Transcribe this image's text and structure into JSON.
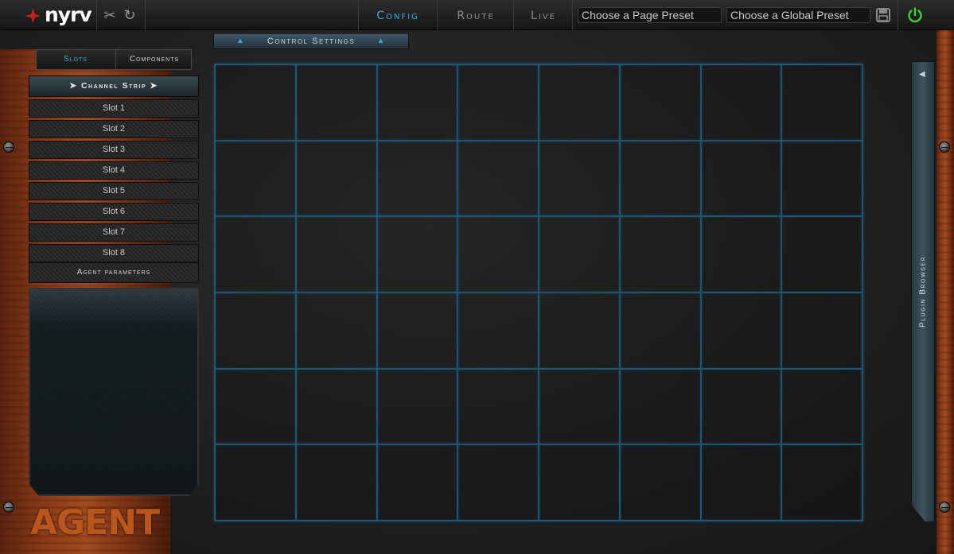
{
  "header": {
    "brand": "nyrv",
    "tabs": [
      {
        "label": "Config",
        "active": true
      },
      {
        "label": "Route",
        "active": false
      },
      {
        "label": "Live",
        "active": false
      }
    ],
    "page_preset_placeholder": "Choose a Page Preset",
    "global_preset_placeholder": "Choose a Global Preset",
    "icons": [
      "tools-icon",
      "refresh-icon",
      "save-icon",
      "power-icon"
    ]
  },
  "control_settings": {
    "label": "Control Settings"
  },
  "sidebar": {
    "tabs": {
      "slots": "Slots",
      "components": "Components"
    },
    "channel_strip": "Channel Strip",
    "slots": [
      "Slot 1",
      "Slot 2",
      "Slot 3",
      "Slot 4",
      "Slot 5",
      "Slot 6",
      "Slot 7",
      "Slot 8"
    ],
    "agent_parameters": "Agent parameters",
    "logo": "AGENT"
  },
  "grid": {
    "columns": 8,
    "rows": 6
  },
  "plugin_browser": {
    "label": "Plugin Browser"
  },
  "colors": {
    "accent": "#3aa9d8",
    "power": "#3fd23a",
    "wood": "#8a3a18"
  }
}
